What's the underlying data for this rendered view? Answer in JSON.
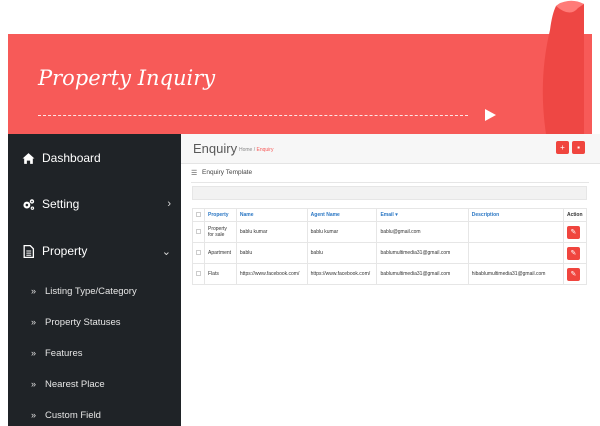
{
  "banner": {
    "title": "Property Inquiry"
  },
  "sidebar": {
    "items": [
      {
        "label": "Dashboard",
        "icon": "home-icon"
      },
      {
        "label": "Setting",
        "icon": "cogs-icon",
        "chevron": "›"
      },
      {
        "label": "Property",
        "icon": "document-icon",
        "chevron": "⌄"
      }
    ],
    "subitems": [
      {
        "label": "Listing Type/Category"
      },
      {
        "label": "Property Statuses"
      },
      {
        "label": "Features"
      },
      {
        "label": "Nearest Place"
      },
      {
        "label": "Custom Field"
      }
    ]
  },
  "main": {
    "title": "Enquiry",
    "breadcrumb": {
      "home": "Home",
      "sep": "/",
      "current": "Enquiry"
    },
    "panel_title": "Enquiry Template",
    "table": {
      "headers": [
        "Property",
        "Name",
        "Agent Name",
        "Email",
        "Description",
        "Action"
      ],
      "email_sort_glyph": "▾",
      "rows": [
        {
          "property": "Property for sale",
          "name": "bablu kumar",
          "agent": "bablu kumar",
          "email": "bablu@gmail.com",
          "description": ""
        },
        {
          "property": "Apartment",
          "name": "bablu",
          "agent": "bablu",
          "email": "bablumultimedia31@gmail.com",
          "description": ""
        },
        {
          "property": "Flats",
          "name": "https://www.facebook.com/",
          "agent": "https://www.facebook.com/",
          "email": "bablumultimedia31@gmail.com",
          "description": "hibablumultimedia31@gmail.com"
        }
      ]
    }
  },
  "colors": {
    "accent": "#f75a58",
    "button": "#f0453e",
    "sidebar_bg": "#1f2327",
    "link": "#2b77c4"
  }
}
